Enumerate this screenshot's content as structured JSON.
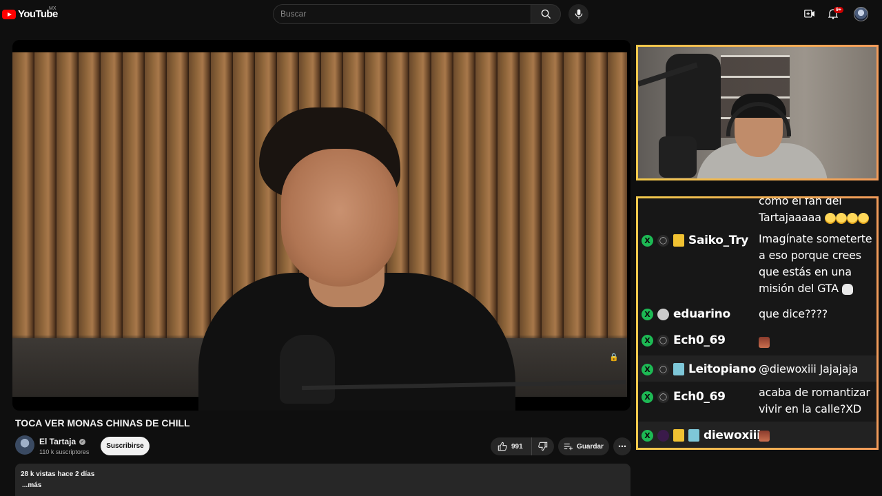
{
  "header": {
    "logo_text": "YouTube",
    "region": "MX",
    "search_placeholder": "Buscar",
    "notifications_badge": "9+"
  },
  "video": {
    "title": "TOCA VER MONAS CHINAS DE CHILL",
    "channel_name": "El Tartaja",
    "subscribers": "110 k suscriptores",
    "subscribe_label": "Suscribirse",
    "likes": "991",
    "save_label": "Guardar",
    "views_date": "28 k vistas  hace 2 días",
    "more_label": "...más"
  },
  "chat": {
    "partial_top": {
      "message_line1": "como el fan del",
      "message_line2": "Tartajaaaaa"
    },
    "messages": [
      {
        "user": "Saiko_Try",
        "message": "Imagínate someterte a eso porque crees que estás en una misión del GTA"
      },
      {
        "user": "eduarino",
        "message": "que dice????"
      },
      {
        "user": "Ech0_69",
        "message": ""
      },
      {
        "user": "Leitopiano",
        "message": "@diewoxiii Jajajaja"
      },
      {
        "user": "Ech0_69",
        "message": "acaba de romantizar vivir en la calle?XD"
      },
      {
        "user": "diewoxiii",
        "message": ""
      }
    ]
  },
  "colors": {
    "accent_border": "#f0b84a",
    "brand_red": "#ff0000",
    "chat_badge_green": "#1db954"
  }
}
